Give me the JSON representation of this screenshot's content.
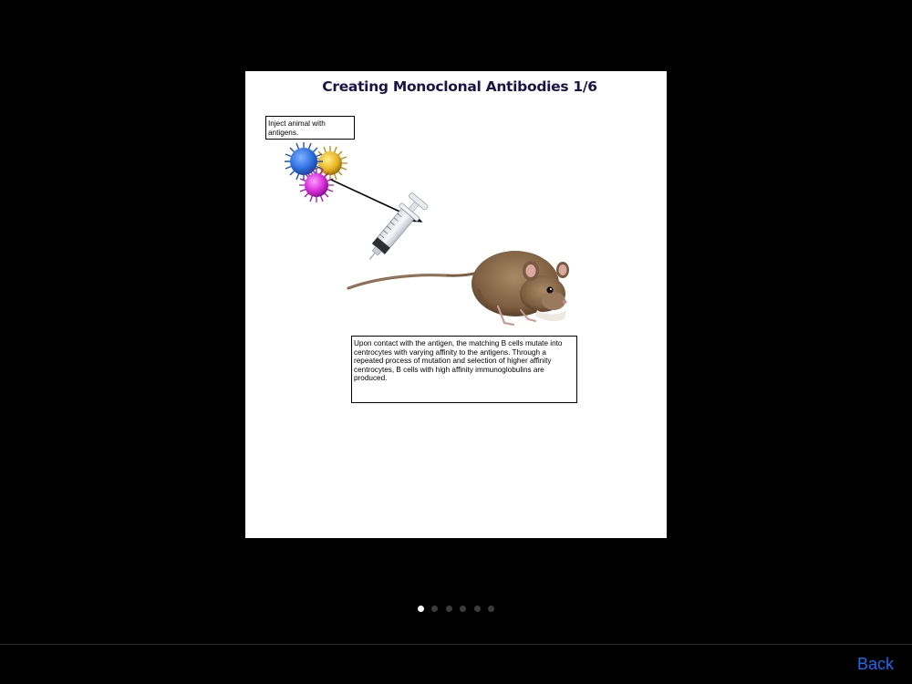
{
  "slide": {
    "title": "Creating Monoclonal Antibodies 1/6",
    "caption_inject": "Inject animal with antigens.",
    "caption_contact": "Upon contact with the antigen, the matching B cells mutate into centrocytes with varying affinity to the antigens. Through a repeated process of mutation and selection of higher affinity centrocytes, B cells with high affinity immunoglobulins are produced."
  },
  "pager": {
    "total": 6,
    "current": 1
  },
  "nav": {
    "back_label": "Back"
  },
  "colors": {
    "background": "#000000",
    "slide_bg": "#ffffff",
    "title": "#1c1446",
    "link": "#1a6cf5",
    "dot_active": "#ffffff",
    "dot_inactive": "#3b3b3b",
    "antigen_blue": "#2f6fe0",
    "antigen_yellow": "#e8b421",
    "antigen_magenta": "#d62ad8",
    "mouse_fur": "#8a6a4a"
  },
  "icons": [
    "antigen-cluster",
    "syringe-icon",
    "mouse-illustration",
    "arrow"
  ]
}
